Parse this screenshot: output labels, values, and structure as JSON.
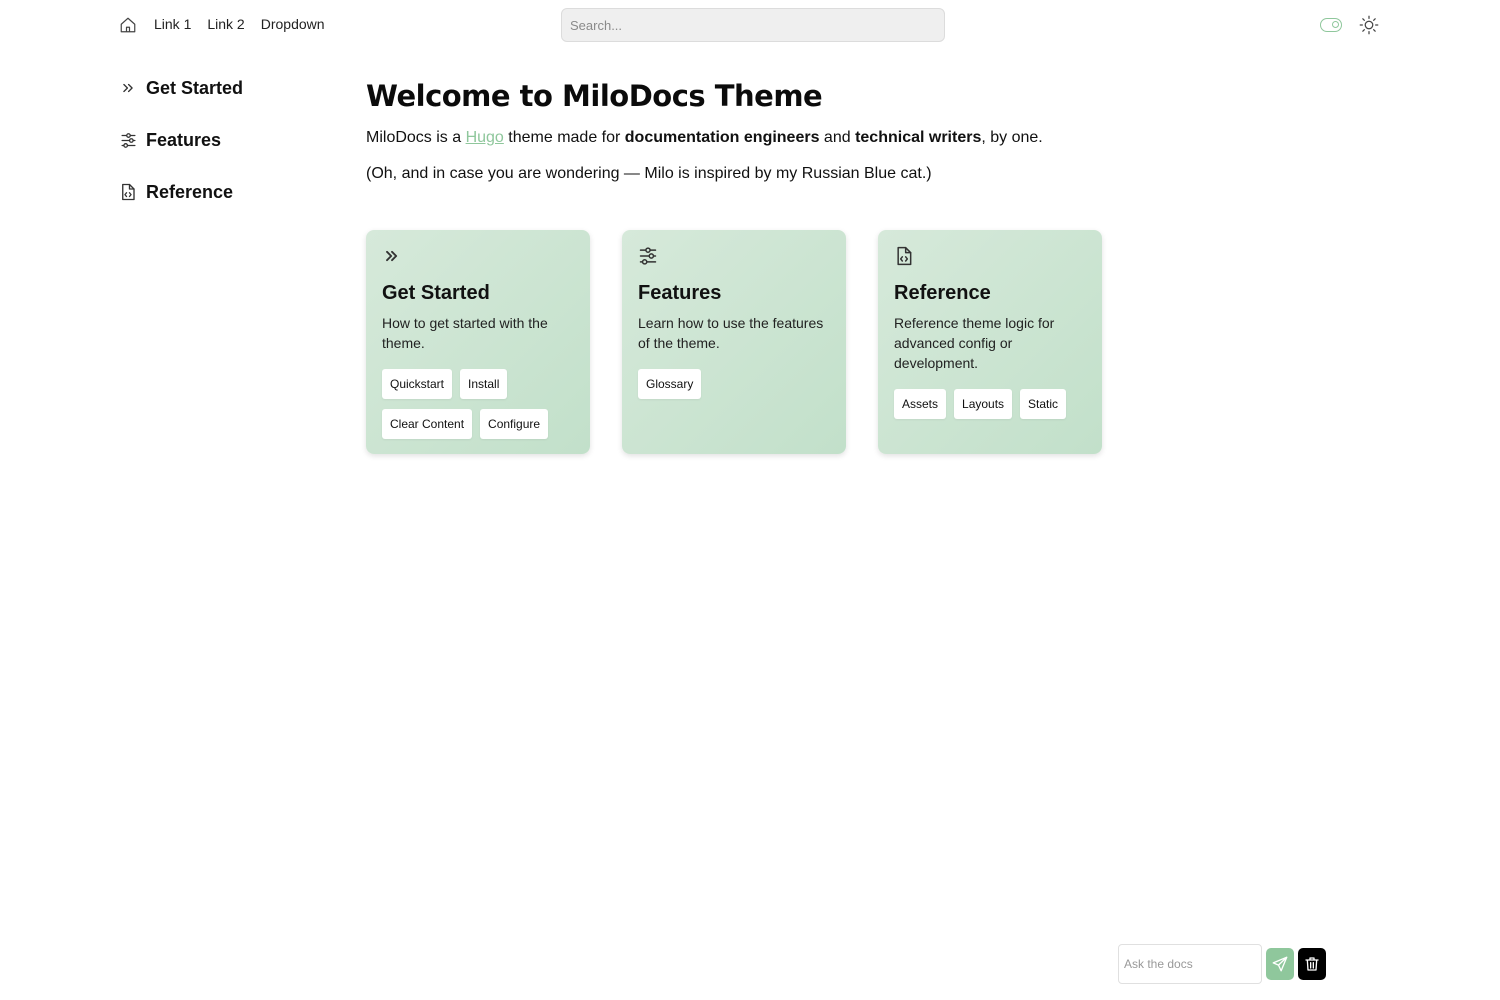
{
  "nav": {
    "home_icon": "home-icon",
    "links": [
      "Link 1",
      "Link 2",
      "Dropdown"
    ],
    "search_placeholder": "Search...",
    "toggle_icon": "toggle-icon",
    "theme_icon": "sun-icon"
  },
  "sidebar": {
    "items": [
      {
        "label": "Get Started",
        "icon": "double-chevron-right-icon"
      },
      {
        "label": "Features",
        "icon": "sliders-icon"
      },
      {
        "label": "Reference",
        "icon": "file-code-icon"
      }
    ]
  },
  "main": {
    "title": "Welcome to MiloDocs Theme",
    "lead": {
      "p1": "MiloDocs is a ",
      "link": "Hugo",
      "p2": " theme made for ",
      "b1": "documentation engineers",
      "p3": " and ",
      "b2": "technical writers",
      "p4": ", by one."
    },
    "note": "(Oh, and in case you are wondering — Milo is inspired by my Russian Blue cat.)"
  },
  "cards": [
    {
      "title": "Get Started",
      "icon": "double-chevron-right-icon",
      "desc": "How to get started with the theme.",
      "tags": [
        "Quickstart",
        "Install",
        "Clear Content",
        "Configure"
      ]
    },
    {
      "title": "Features",
      "icon": "sliders-icon",
      "desc": "Learn how to use the features of the theme.",
      "tags": [
        "Glossary"
      ]
    },
    {
      "title": "Reference",
      "icon": "file-code-icon",
      "desc": "Reference theme logic for advanced config or development.",
      "tags": [
        "Assets",
        "Layouts",
        "Static"
      ]
    }
  ],
  "ask": {
    "placeholder": "Ask the docs",
    "send_icon": "send-icon",
    "clear_icon": "trash-icon"
  },
  "colors": {
    "accent": "#8fc79c",
    "card_bg_start": "#d6e9da",
    "card_bg_end": "#c2e0ca"
  }
}
